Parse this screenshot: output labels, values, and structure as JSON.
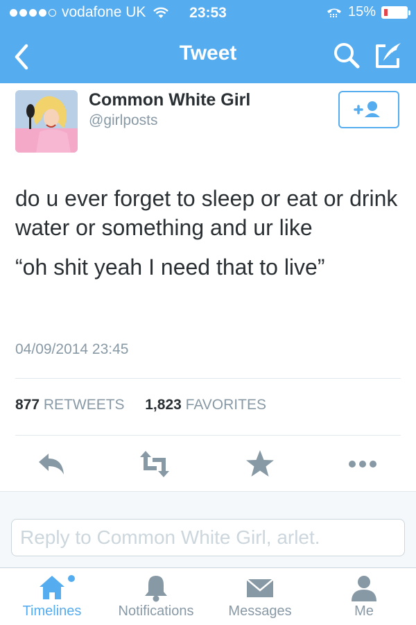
{
  "status_bar": {
    "carrier": "vodafone UK",
    "time": "23:53",
    "battery_text": "15%",
    "battery_level": 0.15,
    "signal_bars": 4,
    "signal_max": 5
  },
  "nav": {
    "title": "Tweet",
    "back_icon": "chevron-left-icon",
    "search_icon": "search-icon",
    "compose_icon": "compose-icon"
  },
  "tweet": {
    "author_name": "Common White Girl",
    "author_handle": "@girlposts",
    "text_line1": "do u ever forget to sleep or eat or drink water or something and ur like",
    "text_line2": "“oh shit yeah I need that to live”",
    "timestamp": "04/09/2014 23:45",
    "retweets_count": "877",
    "retweets_label": "RETWEETS",
    "favorites_count": "1,823",
    "favorites_label": "FAVORITES"
  },
  "reply": {
    "placeholder": "Reply to Common White Girl, arlet."
  },
  "tabs": [
    {
      "label": "Timelines",
      "icon": "home-icon"
    },
    {
      "label": "Notifications",
      "icon": "bell-icon"
    },
    {
      "label": "Messages",
      "icon": "envelope-icon"
    },
    {
      "label": "Me",
      "icon": "person-icon"
    }
  ],
  "colors": {
    "brand": "#55acee",
    "text": "#292f33",
    "muted": "#8899a6",
    "icon": "#8899a6"
  }
}
